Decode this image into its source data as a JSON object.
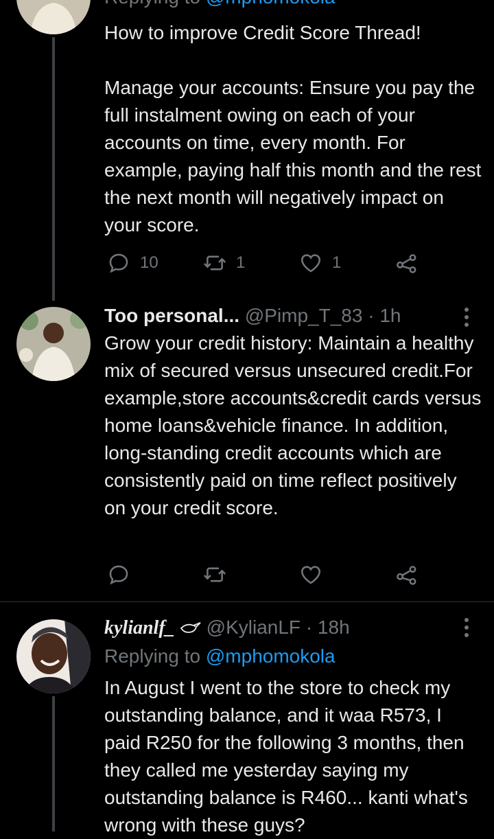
{
  "tweet1": {
    "replying_prefix": "Replying to",
    "replying_handle": "@mphomokola",
    "title": "How to improve Credit Score Thread!",
    "body": "Manage your accounts: Ensure you pay the full instalment owing on each of your accounts on time, every month. For example, paying half this month and the rest the next month will negatively impact on your score.",
    "replies": "10",
    "retweets": "1",
    "likes": "1"
  },
  "tweet2": {
    "display_name": "Too personal...",
    "handle": "@Pimp_T_83",
    "time": "· 1h",
    "body": "Grow your credit history: Maintain a healthy mix of secured versus unsecured credit.For example,store accounts&credit cards versus home loans&vehicle finance. In addition, long-standing credit accounts which are consistently paid on time reflect positively on your credit score."
  },
  "tweet3": {
    "display_name": "kylianlf_",
    "handle": "@KylianLF",
    "time": "· 18h",
    "replying_prefix": "Replying to",
    "replying_handle": "@mphomokola",
    "body": "In August I went to the store to check my outstanding balance, and it waa R573, I paid R250 for the following 3 months, then they called me yesterday saying my outstanding balance is R460... kanti what's wrong with these guys?"
  },
  "colors": {
    "background": "#000000",
    "text": "#e7e9ea",
    "muted": "#71767b",
    "link": "#1d9bf0",
    "divider": "#2f3336"
  }
}
